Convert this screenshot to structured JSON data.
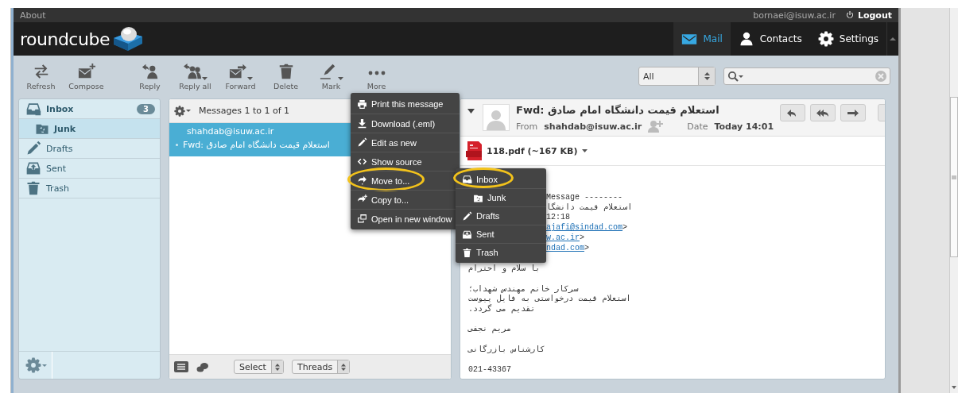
{
  "topline": {
    "about": "About",
    "user": "bornaei@isuw.ac.ir",
    "logout": "Logout"
  },
  "header": {
    "logo": "roundcube",
    "nav": [
      {
        "label": "Mail",
        "kind": "mail",
        "selected": true
      },
      {
        "label": "Contacts",
        "kind": "person",
        "selected": false
      },
      {
        "label": "Settings",
        "kind": "gear",
        "selected": false
      }
    ]
  },
  "toolbar": {
    "compose_group": [
      {
        "label": "Refresh",
        "kind": "refresh",
        "dropdown": false
      },
      {
        "label": "Compose",
        "kind": "compose",
        "dropdown": false
      }
    ],
    "message_group": [
      {
        "label": "Reply",
        "kind": "reply",
        "dropdown": false
      },
      {
        "label": "Reply all",
        "kind": "replyall",
        "dropdown": true
      },
      {
        "label": "Forward",
        "kind": "forward",
        "dropdown": true
      },
      {
        "label": "Delete",
        "kind": "trash",
        "dropdown": false
      },
      {
        "label": "Mark",
        "kind": "mark",
        "dropdown": true
      },
      {
        "label": "More",
        "kind": "more",
        "dropdown": false
      }
    ],
    "filter": {
      "value": "All"
    }
  },
  "folders": [
    {
      "name": "Inbox",
      "kind": "inbox",
      "unread": "3",
      "selected": false,
      "children": [
        {
          "name": "Junk",
          "kind": "junk",
          "selected": true
        }
      ]
    },
    {
      "name": "Drafts",
      "kind": "drafts",
      "selected": false
    },
    {
      "name": "Sent",
      "kind": "sent",
      "selected": false
    },
    {
      "name": "Trash",
      "kind": "trash",
      "selected": false
    }
  ],
  "message_list": {
    "count": "Messages 1 to 1 of 1",
    "rows": [
      {
        "from": "shahdab@isuw.ac.ir",
        "subject": "Fwd: استعلام قیمت دانشگاه امام صادق",
        "selected": true
      }
    ],
    "footer": {
      "select": "Select",
      "threads": "Threads"
    }
  },
  "preview": {
    "subject": "Fwd: استعلام قیمت دانشگاه امام صادق",
    "from_label": "From",
    "from": "shahdab@isuw.ac.ir",
    "date_label": "Date",
    "date": "Today 14:01",
    "attachment": "118.pdf (~167 KB)",
    "paragraphs": [
      [
        {
          "kind": "clipped",
          "text": "Message --------"
        },
        {
          "kind": "clipped",
          "text": "استعلام قیمت دانشگا"
        },
        {
          "kind": "clipped",
          "text": "12:18"
        },
        {
          "kind": "clipped",
          "link": "ajafi@sindad.com",
          "text": ">"
        },
        {
          "kind": "clipped",
          "link": "w.ac.ir",
          "text": ">"
        },
        {
          "kind": "clipped",
          "link": "ndad.com",
          "text": ">"
        }
      ],
      [
        {
          "kind": "plain",
          "text": "با سلام و احترام"
        }
      ],
      [
        {
          "kind": "plain",
          "text": "سرکار خانم مهندس شهداب؛"
        },
        {
          "kind": "plain",
          "text": "استعلام قیمت درخواستی به فایل پیوست"
        },
        {
          "kind": "plain",
          "text": "تقدیم می گردد."
        }
      ],
      [
        {
          "kind": "plain",
          "text": "مریم نجفی"
        }
      ],
      [
        {
          "kind": "plain",
          "text": "کارشناس بازرگانی"
        }
      ],
      [
        {
          "kind": "plain",
          "text": "021-43367"
        }
      ]
    ]
  },
  "menu": {
    "items": [
      {
        "label": "Print this message",
        "kind": "print",
        "circled": false
      },
      {
        "label": "Download (.eml)",
        "kind": "download",
        "circled": false
      },
      {
        "label": "Edit as new",
        "kind": "drafts",
        "circled": false
      },
      {
        "label": "Show source",
        "kind": "source",
        "circled": false
      },
      {
        "label": "Move to...",
        "kind": "move",
        "circled": true
      },
      {
        "label": "Copy to...",
        "kind": "copy",
        "circled": false
      },
      {
        "label": "Open in new window",
        "kind": "window",
        "circled": false
      }
    ]
  },
  "submenu": {
    "items": [
      {
        "label": "Inbox",
        "kind": "inbox",
        "circled": true,
        "children": [
          {
            "label": "Junk",
            "kind": "junk",
            "circled": false
          }
        ]
      },
      {
        "label": "Drafts",
        "kind": "drafts",
        "circled": false
      },
      {
        "label": "Sent",
        "kind": "sent",
        "circled": false
      },
      {
        "label": "Trash",
        "kind": "trash",
        "circled": false
      }
    ]
  }
}
